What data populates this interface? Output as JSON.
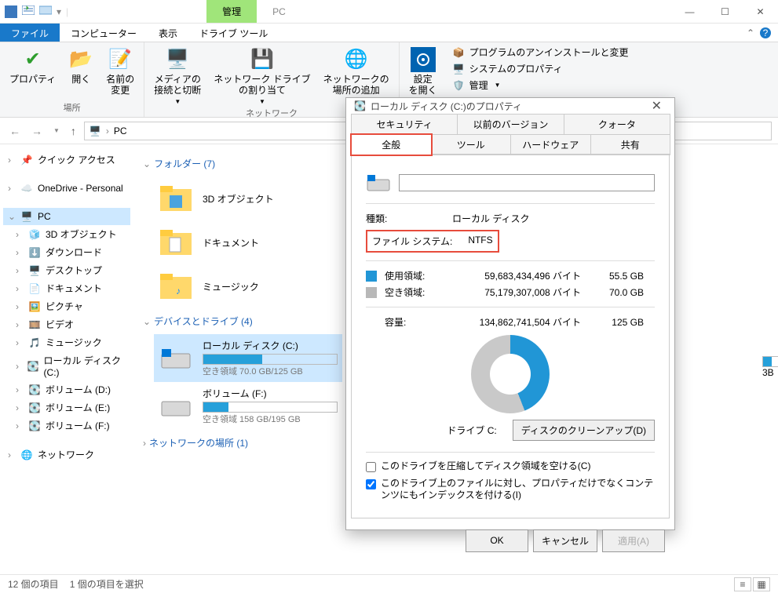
{
  "titlebar": {
    "contextTab": "管理",
    "title": "PC"
  },
  "menutabs": {
    "file": "ファイル",
    "computer": "コンピューター",
    "view": "表示",
    "driveTools": "ドライブ ツール"
  },
  "ribbon": {
    "properties": "プロパティ",
    "open": "開く",
    "rename": "名前の\n変更",
    "group1": "場所",
    "media": "メディアの\n接続と切断",
    "netDrive": "ネットワーク ドライブ\nの割り当て",
    "addNet": "ネットワークの\n場所の追加",
    "group2": "ネットワーク",
    "settings": "設定\nを開く",
    "side1": "プログラムのアンインストールと変更",
    "side2": "システムのプロパティ",
    "side3": "管理"
  },
  "breadcrumb": {
    "pc": "PC"
  },
  "sidebar": {
    "quickAccess": "クイック アクセス",
    "onedrive": "OneDrive - Personal",
    "pc": "PC",
    "items": [
      "3D オブジェクト",
      "ダウンロード",
      "デスクトップ",
      "ドキュメント",
      "ピクチャ",
      "ビデオ",
      "ミュージック",
      "ローカル ディスク (C:)",
      "ボリューム (D:)",
      "ボリューム (E:)",
      "ボリューム (F:)"
    ],
    "network": "ネットワーク"
  },
  "content": {
    "foldersHeader": "フォルダー (7)",
    "folders": [
      "3D オブジェクト",
      "ドキュメント",
      "ミュージック"
    ],
    "drivesHeader": "デバイスとドライブ (4)",
    "driveC": {
      "name": "ローカル ディスク (C:)",
      "sub": "空き領域 70.0 GB/125 GB",
      "fillPct": 44
    },
    "driveF": {
      "name": "ボリューム (F:)",
      "sub": "空き領域 158 GB/195 GB",
      "fillPct": 19
    },
    "rightHidden": "3B",
    "netHeader": "ネットワークの場所 (1)"
  },
  "status": {
    "count": "12 個の項目",
    "sel": "1 個の項目を選択"
  },
  "dialog": {
    "title": "ローカル ディスク (C:)のプロパティ",
    "tabsTop": [
      "セキュリティ",
      "以前のバージョン",
      "クォータ"
    ],
    "tabsBottom": [
      "全般",
      "ツール",
      "ハードウェア",
      "共有"
    ],
    "typeLabel": "種類:",
    "typeValue": "ローカル ディスク",
    "fsLabel": "ファイル システム:",
    "fsValue": "NTFS",
    "usedLabel": "使用領域:",
    "usedBytes": "59,683,434,496 バイト",
    "usedGB": "55.5 GB",
    "freeLabel": "空き領域:",
    "freeBytes": "75,179,307,008 バイト",
    "freeGB": "70.0 GB",
    "capLabel": "容量:",
    "capBytes": "134,862,741,504 バイト",
    "capGB": "125 GB",
    "driveLabel": "ドライブ C:",
    "cleanup": "ディスクのクリーンアップ(D)",
    "chk1": "このドライブを圧縮してディスク領域を空ける(C)",
    "chk2": "このドライブ上のファイルに対し、プロパティだけでなくコンテンツにもインデックスを付ける(I)",
    "ok": "OK",
    "cancel": "キャンセル",
    "apply": "適用(A)"
  }
}
